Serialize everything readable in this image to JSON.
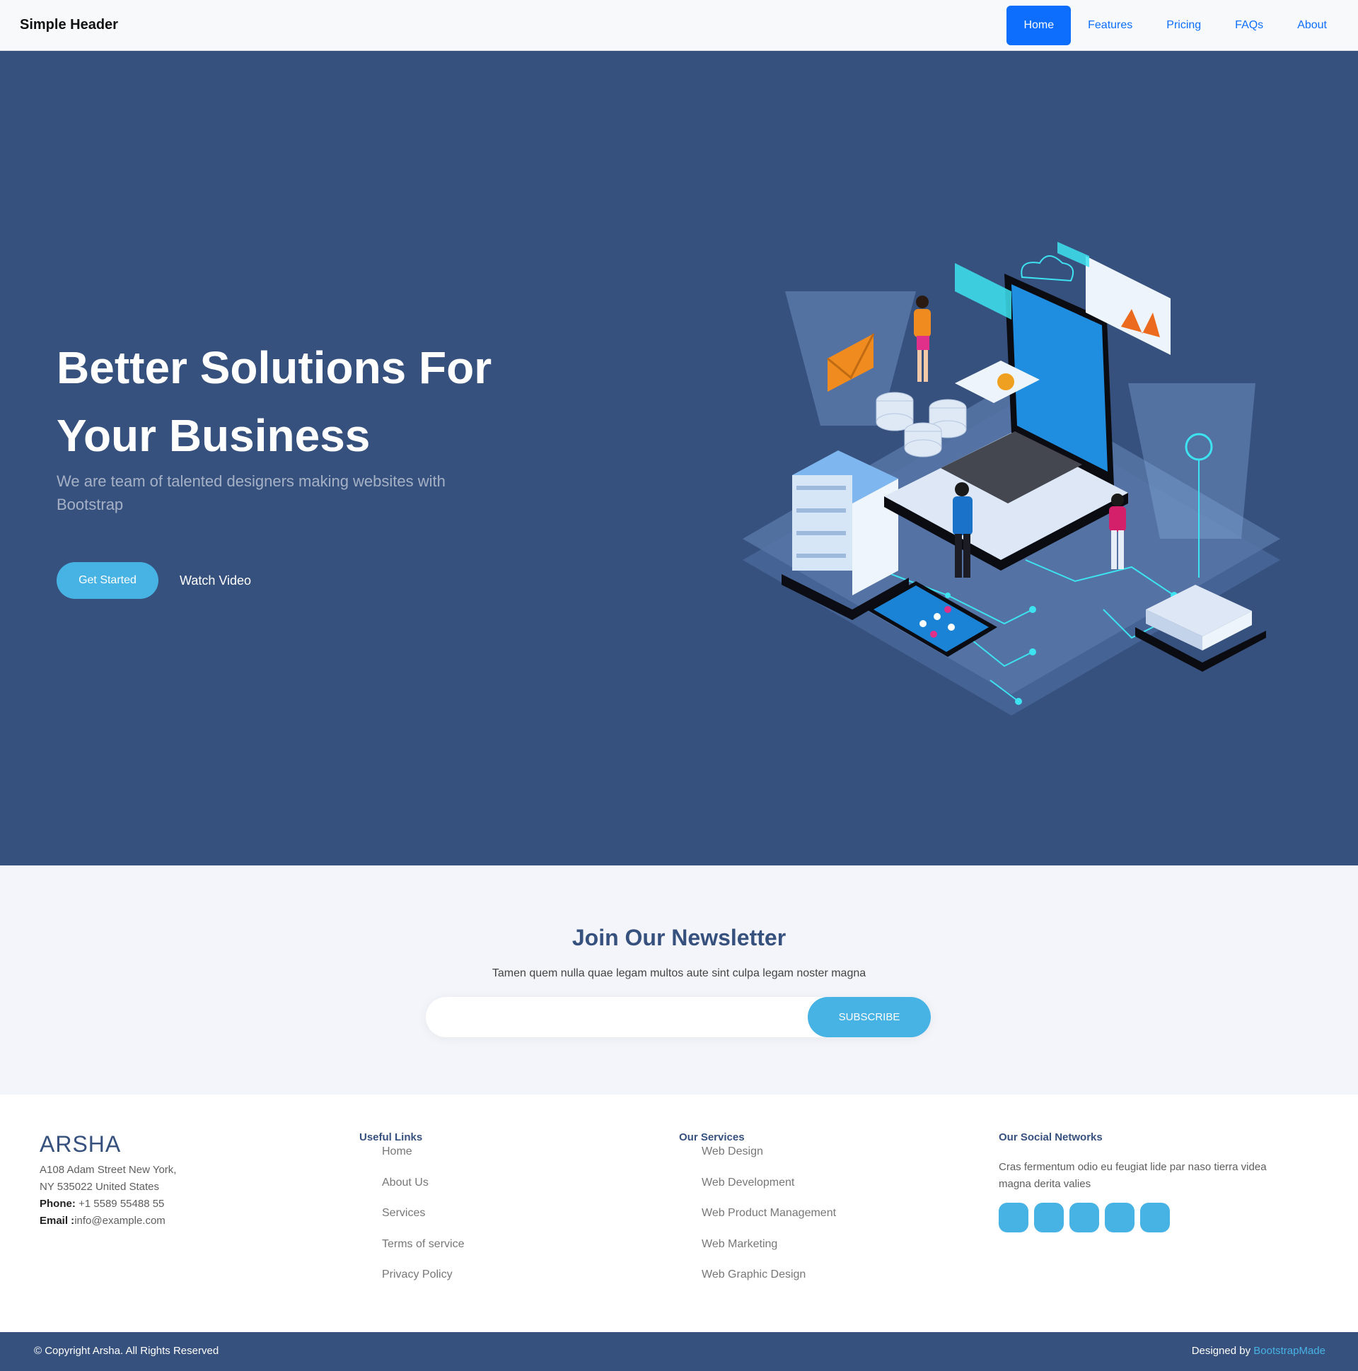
{
  "header": {
    "brand": "Simple Header",
    "nav": [
      "Home",
      "Features",
      "Pricing",
      "FAQs",
      "About"
    ],
    "active": "Home"
  },
  "hero": {
    "title": "Better Solutions For Your Business",
    "subtitle": "We are team of talented designers making websites with Bootstrap",
    "cta_primary": "Get Started",
    "cta_secondary": "Watch Video",
    "illustration": "isometric-laptop-servers-illustration"
  },
  "newsletter": {
    "title": "Join Our Newsletter",
    "text": "Tamen quem nulla quae legam multos aute sint culpa legam noster magna",
    "input_placeholder": "",
    "button": "SUBSCRIBE"
  },
  "footer": {
    "logo": "ARSHA",
    "address_line1": "A108 Adam Street New York,",
    "address_line2": "NY 535022 United States",
    "phone_label": "Phone:",
    "phone": "+1 5589 55488 55",
    "email_label": "Email :",
    "email": "info@example.com",
    "useful_links_title": "Useful Links",
    "useful_links": [
      "Home",
      "About Us",
      "Services",
      "Terms of service",
      "Privacy Policy"
    ],
    "services_title": "Our Services",
    "services": [
      "Web Design",
      "Web Development",
      "Web Product Management",
      "Web Marketing",
      "Web Graphic Design"
    ],
    "social_title": "Our Social Networks",
    "social_text": "Cras fermentum odio eu feugiat lide par naso tierra videa magna derita valies",
    "social_icons": [
      "social-icon-1",
      "social-icon-2",
      "social-icon-3",
      "social-icon-4",
      "social-icon-5"
    ]
  },
  "bottom": {
    "copyright": "© Copyright Arsha. All Rights Reserved",
    "credits_prefix": "Designed by",
    "credits_link": "BootstrapMade"
  },
  "colors": {
    "primary": "#37517e",
    "accent": "#47b2e4",
    "nav_active": "#0d6efd"
  }
}
